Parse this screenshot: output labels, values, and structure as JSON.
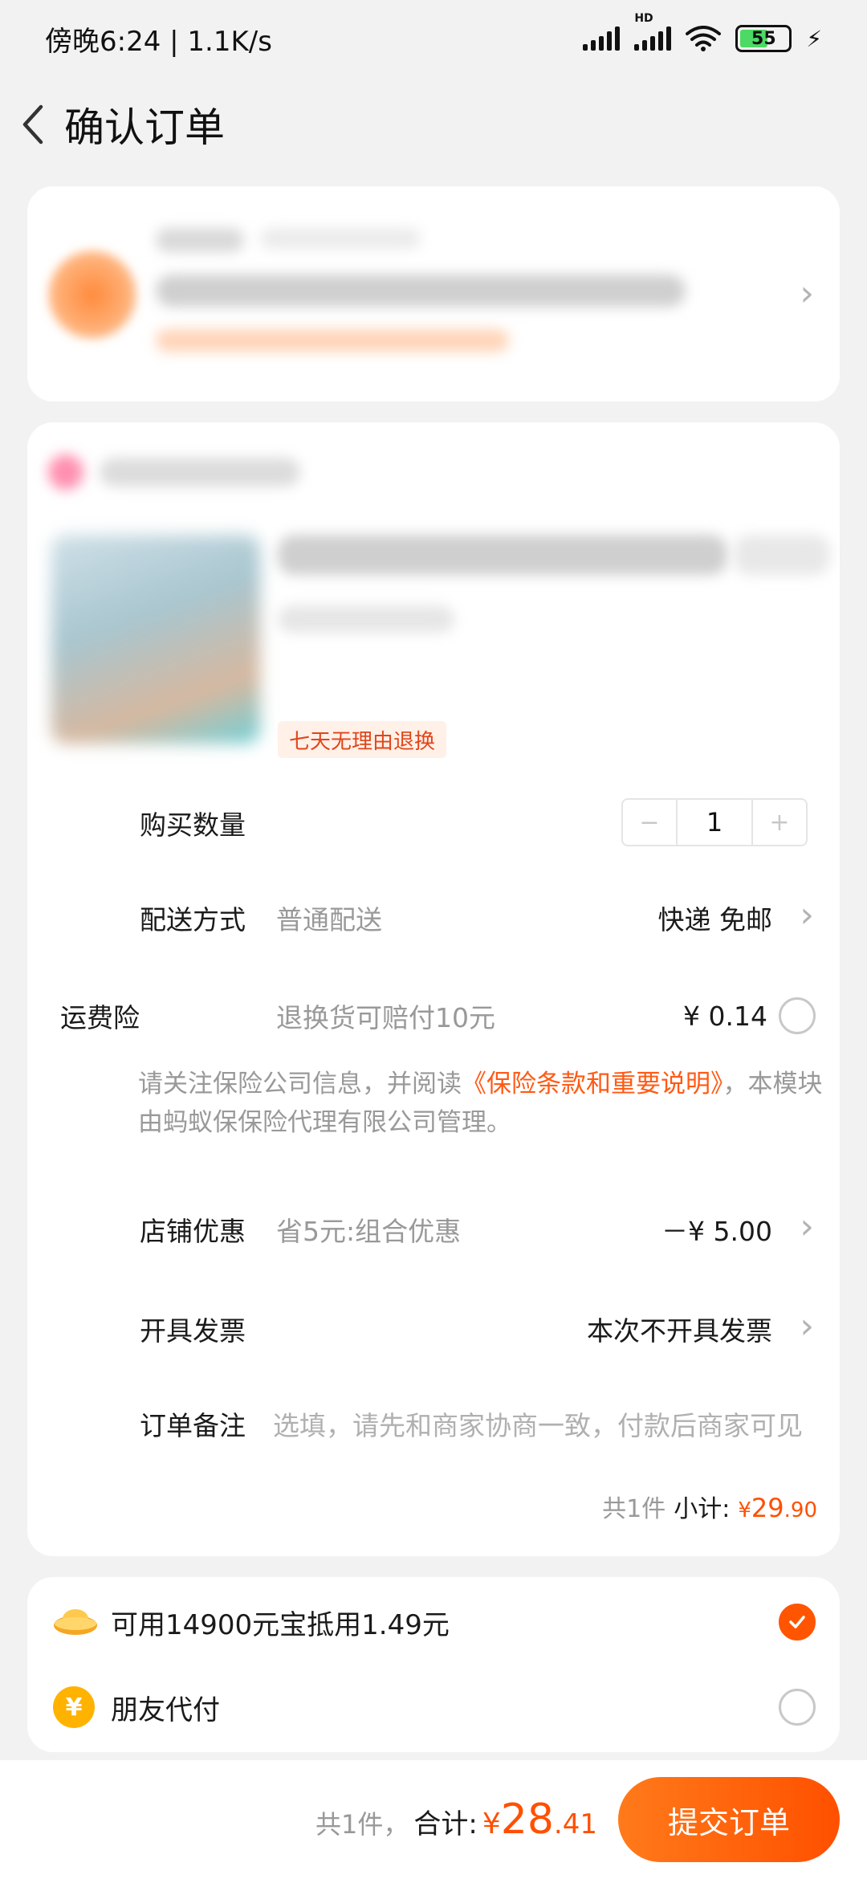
{
  "status_bar": {
    "time_speed": "傍晚6:24 | 1.1K/s",
    "hd_label": "HD",
    "battery": "55",
    "battery_level_percent": 55
  },
  "header": {
    "title": "确认订单"
  },
  "product": {
    "return_tag": "七天无理由退换"
  },
  "rows": {
    "quantity": {
      "label": "购买数量",
      "minus": "−",
      "value": "1",
      "plus": "+"
    },
    "delivery": {
      "label": "配送方式",
      "sub": "普通配送",
      "value": "快递 免邮"
    },
    "shipping_insurance": {
      "label": "运费险",
      "sub": "退换货可赔付10元",
      "value": "¥ 0.14"
    },
    "notice": {
      "prefix": "请关注保险公司信息，并阅读",
      "link": "《保险条款和重要说明》",
      "suffix": "，本模块由蚂蚁保保险代理有限公司管理。"
    },
    "shop_discount": {
      "label": "店铺优惠",
      "sub": "省5元:组合优惠",
      "value": "－¥ 5.00"
    },
    "invoice": {
      "label": "开具发票",
      "value": "本次不开具发票"
    },
    "remark": {
      "label": "订单备注",
      "placeholder": "选填，请先和商家协商一致，付款后商家可见"
    }
  },
  "subtotal": {
    "count": "共1件",
    "label": "小计:",
    "yen": "¥",
    "int": "29",
    "dec": ".90"
  },
  "payment": {
    "points": {
      "text": "可用14900元宝抵用1.49元",
      "checked": true
    },
    "friend_pay": {
      "text": "朋友代付",
      "icon": "¥",
      "checked": false
    }
  },
  "bottom": {
    "count": "共1件，",
    "label": "合计:",
    "yen": "¥",
    "int": "28",
    "dec": ".41",
    "submit": "提交订单"
  },
  "colors": {
    "accent": "#ff5000",
    "background": "#f2f2f2"
  }
}
